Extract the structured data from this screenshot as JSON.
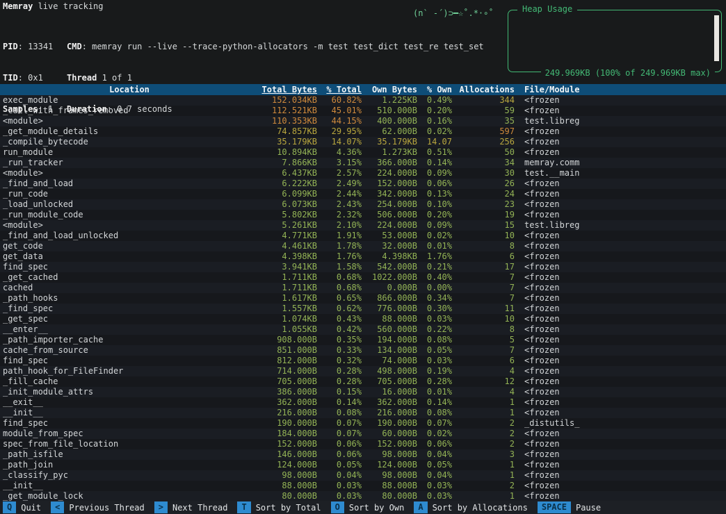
{
  "app": {
    "title_bold": "Memray",
    "title_rest": " live tracking",
    "kawaii_art": "(n` -´)⊃━☆˚.*·∘˚"
  },
  "stats": {
    "pid_label": "PID",
    "pid": "13341",
    "cmd_label": "CMD",
    "cmd": "memray run --live --trace-python-allocators -m test test_dict test_re test_set",
    "tid_label": "TID",
    "tid": "0x1",
    "thread_label": "Thread",
    "thread": "1 of 1",
    "samples_label": "Samples",
    "samples": "1",
    "duration_label": "Duration",
    "duration": "0.7 seconds"
  },
  "heap": {
    "title": "Heap Usage",
    "caption": "249.969KB (100% of 249.969KB max)"
  },
  "table": {
    "headers": {
      "location": "Location",
      "total_bytes": "Total Bytes",
      "pct_total": "% Total",
      "own_bytes": "Own Bytes",
      "pct_own": "% Own",
      "allocations": "Allocations",
      "file_module": "File/Module"
    },
    "sorted_columns": [
      "total_bytes",
      "pct_total"
    ],
    "rows": [
      {
        "location": "exec_module",
        "total": "152.034KB",
        "pct_total": "60.82%",
        "own": "1.225KB",
        "pct_own": "0.49%",
        "allocs": "344",
        "file": "<frozen",
        "tone_total": "orange",
        "tone_own": "green",
        "tone_alloc": "yellow"
      },
      {
        "location": "_call_with_frames_removed",
        "total": "112.521KB",
        "pct_total": "45.01%",
        "own": "510.000B",
        "pct_own": "0.20%",
        "allocs": "59",
        "file": "<frozen",
        "tone_total": "orange",
        "tone_own": "green",
        "tone_alloc": "green"
      },
      {
        "location": "<module>",
        "total": "110.353KB",
        "pct_total": "44.15%",
        "own": "400.000B",
        "pct_own": "0.16%",
        "allocs": "35",
        "file": "test.libreg",
        "tone_total": "orange",
        "tone_own": "green",
        "tone_alloc": "green"
      },
      {
        "location": "_get_module_details",
        "total": "74.857KB",
        "pct_total": "29.95%",
        "own": "62.000B",
        "pct_own": "0.02%",
        "allocs": "597",
        "file": "<frozen",
        "tone_total": "yellow",
        "tone_own": "green",
        "tone_alloc": "orange"
      },
      {
        "location": "_compile_bytecode",
        "total": "35.179KB",
        "pct_total": "14.07%",
        "own": "35.179KB",
        "pct_own": "14.07",
        "allocs": "256",
        "file": "<frozen",
        "tone_total": "yellow",
        "tone_own": "yellow",
        "tone_alloc": "yellow"
      },
      {
        "location": "run_module",
        "total": "10.894KB",
        "pct_total": "4.36%",
        "own": "1.273KB",
        "pct_own": "0.51%",
        "allocs": "50",
        "file": "<frozen",
        "tone_total": "green",
        "tone_own": "green",
        "tone_alloc": "green"
      },
      {
        "location": "_run_tracker",
        "total": "7.866KB",
        "pct_total": "3.15%",
        "own": "366.000B",
        "pct_own": "0.14%",
        "allocs": "34",
        "file": "memray.comm",
        "tone_total": "green",
        "tone_own": "green",
        "tone_alloc": "green"
      },
      {
        "location": "<module>",
        "total": "6.437KB",
        "pct_total": "2.57%",
        "own": "224.000B",
        "pct_own": "0.09%",
        "allocs": "30",
        "file": "test.__main",
        "tone_total": "green",
        "tone_own": "green",
        "tone_alloc": "green"
      },
      {
        "location": "_find_and_load",
        "total": "6.222KB",
        "pct_total": "2.49%",
        "own": "152.000B",
        "pct_own": "0.06%",
        "allocs": "26",
        "file": "<frozen",
        "tone_total": "green",
        "tone_own": "green",
        "tone_alloc": "green"
      },
      {
        "location": "_run_code",
        "total": "6.099KB",
        "pct_total": "2.44%",
        "own": "342.000B",
        "pct_own": "0.13%",
        "allocs": "24",
        "file": "<frozen",
        "tone_total": "green",
        "tone_own": "green",
        "tone_alloc": "green"
      },
      {
        "location": "_load_unlocked",
        "total": "6.073KB",
        "pct_total": "2.43%",
        "own": "254.000B",
        "pct_own": "0.10%",
        "allocs": "23",
        "file": "<frozen",
        "tone_total": "green",
        "tone_own": "green",
        "tone_alloc": "green"
      },
      {
        "location": "_run_module_code",
        "total": "5.802KB",
        "pct_total": "2.32%",
        "own": "506.000B",
        "pct_own": "0.20%",
        "allocs": "19",
        "file": "<frozen",
        "tone_total": "green",
        "tone_own": "green",
        "tone_alloc": "green"
      },
      {
        "location": "<module>",
        "total": "5.261KB",
        "pct_total": "2.10%",
        "own": "224.000B",
        "pct_own": "0.09%",
        "allocs": "15",
        "file": "test.libreg",
        "tone_total": "green",
        "tone_own": "green",
        "tone_alloc": "green"
      },
      {
        "location": "_find_and_load_unlocked",
        "total": "4.771KB",
        "pct_total": "1.91%",
        "own": "53.000B",
        "pct_own": "0.02%",
        "allocs": "10",
        "file": "<frozen",
        "tone_total": "green",
        "tone_own": "green",
        "tone_alloc": "green"
      },
      {
        "location": "get_code",
        "total": "4.461KB",
        "pct_total": "1.78%",
        "own": "32.000B",
        "pct_own": "0.01%",
        "allocs": "8",
        "file": "<frozen",
        "tone_total": "green",
        "tone_own": "green",
        "tone_alloc": "green"
      },
      {
        "location": "get_data",
        "total": "4.398KB",
        "pct_total": "1.76%",
        "own": "4.398KB",
        "pct_own": "1.76%",
        "allocs": "6",
        "file": "<frozen",
        "tone_total": "green",
        "tone_own": "green",
        "tone_alloc": "green"
      },
      {
        "location": "find_spec",
        "total": "3.941KB",
        "pct_total": "1.58%",
        "own": "542.000B",
        "pct_own": "0.21%",
        "allocs": "17",
        "file": "<frozen",
        "tone_total": "green",
        "tone_own": "green",
        "tone_alloc": "green"
      },
      {
        "location": "_get_cached",
        "total": "1.711KB",
        "pct_total": "0.68%",
        "own": "1022.000B",
        "pct_own": "0.40%",
        "allocs": "7",
        "file": "<frozen",
        "tone_total": "green",
        "tone_own": "green",
        "tone_alloc": "green"
      },
      {
        "location": "cached",
        "total": "1.711KB",
        "pct_total": "0.68%",
        "own": "0.000B",
        "pct_own": "0.00%",
        "allocs": "7",
        "file": "<frozen",
        "tone_total": "green",
        "tone_own": "green",
        "tone_alloc": "green"
      },
      {
        "location": "_path_hooks",
        "total": "1.617KB",
        "pct_total": "0.65%",
        "own": "866.000B",
        "pct_own": "0.34%",
        "allocs": "7",
        "file": "<frozen",
        "tone_total": "green",
        "tone_own": "green",
        "tone_alloc": "green"
      },
      {
        "location": "_find_spec",
        "total": "1.557KB",
        "pct_total": "0.62%",
        "own": "776.000B",
        "pct_own": "0.30%",
        "allocs": "11",
        "file": "<frozen",
        "tone_total": "green",
        "tone_own": "green",
        "tone_alloc": "green"
      },
      {
        "location": "_get_spec",
        "total": "1.074KB",
        "pct_total": "0.43%",
        "own": "88.000B",
        "pct_own": "0.03%",
        "allocs": "10",
        "file": "<frozen",
        "tone_total": "green",
        "tone_own": "green",
        "tone_alloc": "green"
      },
      {
        "location": "__enter__",
        "total": "1.055KB",
        "pct_total": "0.42%",
        "own": "560.000B",
        "pct_own": "0.22%",
        "allocs": "8",
        "file": "<frozen",
        "tone_total": "green",
        "tone_own": "green",
        "tone_alloc": "green"
      },
      {
        "location": "_path_importer_cache",
        "total": "908.000B",
        "pct_total": "0.35%",
        "own": "194.000B",
        "pct_own": "0.08%",
        "allocs": "5",
        "file": "<frozen",
        "tone_total": "green",
        "tone_own": "green",
        "tone_alloc": "green"
      },
      {
        "location": "cache_from_source",
        "total": "851.000B",
        "pct_total": "0.33%",
        "own": "134.000B",
        "pct_own": "0.05%",
        "allocs": "7",
        "file": "<frozen",
        "tone_total": "green",
        "tone_own": "green",
        "tone_alloc": "green"
      },
      {
        "location": "find_spec",
        "total": "812.000B",
        "pct_total": "0.32%",
        "own": "74.000B",
        "pct_own": "0.03%",
        "allocs": "6",
        "file": "<frozen",
        "tone_total": "green",
        "tone_own": "green",
        "tone_alloc": "green"
      },
      {
        "location": "path_hook_for_FileFinder",
        "total": "714.000B",
        "pct_total": "0.28%",
        "own": "498.000B",
        "pct_own": "0.19%",
        "allocs": "4",
        "file": "<frozen",
        "tone_total": "green",
        "tone_own": "green",
        "tone_alloc": "green"
      },
      {
        "location": "_fill_cache",
        "total": "705.000B",
        "pct_total": "0.28%",
        "own": "705.000B",
        "pct_own": "0.28%",
        "allocs": "12",
        "file": "<frozen",
        "tone_total": "green",
        "tone_own": "green",
        "tone_alloc": "green"
      },
      {
        "location": "_init_module_attrs",
        "total": "386.000B",
        "pct_total": "0.15%",
        "own": "16.000B",
        "pct_own": "0.01%",
        "allocs": "4",
        "file": "<frozen",
        "tone_total": "green",
        "tone_own": "green",
        "tone_alloc": "green"
      },
      {
        "location": "__exit__",
        "total": "362.000B",
        "pct_total": "0.14%",
        "own": "362.000B",
        "pct_own": "0.14%",
        "allocs": "1",
        "file": "<frozen",
        "tone_total": "green",
        "tone_own": "green",
        "tone_alloc": "green"
      },
      {
        "location": "__init__",
        "total": "216.000B",
        "pct_total": "0.08%",
        "own": "216.000B",
        "pct_own": "0.08%",
        "allocs": "1",
        "file": "<frozen",
        "tone_total": "green",
        "tone_own": "green",
        "tone_alloc": "green"
      },
      {
        "location": "find_spec",
        "total": "190.000B",
        "pct_total": "0.07%",
        "own": "190.000B",
        "pct_own": "0.07%",
        "allocs": "2",
        "file": "_distutils_",
        "tone_total": "green",
        "tone_own": "green",
        "tone_alloc": "green"
      },
      {
        "location": "module_from_spec",
        "total": "184.000B",
        "pct_total": "0.07%",
        "own": "60.000B",
        "pct_own": "0.02%",
        "allocs": "2",
        "file": "<frozen",
        "tone_total": "green",
        "tone_own": "green",
        "tone_alloc": "green"
      },
      {
        "location": "spec_from_file_location",
        "total": "152.000B",
        "pct_total": "0.06%",
        "own": "152.000B",
        "pct_own": "0.06%",
        "allocs": "2",
        "file": "<frozen",
        "tone_total": "green",
        "tone_own": "green",
        "tone_alloc": "green"
      },
      {
        "location": "_path_isfile",
        "total": "146.000B",
        "pct_total": "0.06%",
        "own": "98.000B",
        "pct_own": "0.04%",
        "allocs": "3",
        "file": "<frozen",
        "tone_total": "green",
        "tone_own": "green",
        "tone_alloc": "green"
      },
      {
        "location": "_path_join",
        "total": "124.000B",
        "pct_total": "0.05%",
        "own": "124.000B",
        "pct_own": "0.05%",
        "allocs": "1",
        "file": "<frozen",
        "tone_total": "green",
        "tone_own": "green",
        "tone_alloc": "green"
      },
      {
        "location": "_classify_pyc",
        "total": "98.000B",
        "pct_total": "0.04%",
        "own": "98.000B",
        "pct_own": "0.04%",
        "allocs": "1",
        "file": "<frozen",
        "tone_total": "green",
        "tone_own": "green",
        "tone_alloc": "green"
      },
      {
        "location": "__init__",
        "total": "88.000B",
        "pct_total": "0.03%",
        "own": "88.000B",
        "pct_own": "0.03%",
        "allocs": "2",
        "file": "<frozen",
        "tone_total": "green",
        "tone_own": "green",
        "tone_alloc": "green"
      },
      {
        "location": "_get_module_lock",
        "total": "80.000B",
        "pct_total": "0.03%",
        "own": "80.000B",
        "pct_own": "0.03%",
        "allocs": "1",
        "file": "<frozen",
        "tone_total": "green",
        "tone_own": "green",
        "tone_alloc": "green"
      }
    ]
  },
  "footer": {
    "items": [
      {
        "key": "Q",
        "label": "Quit"
      },
      {
        "key": "<",
        "label": "Previous Thread"
      },
      {
        "key": ">",
        "label": "Next Thread"
      },
      {
        "key": "T",
        "label": "Sort by Total"
      },
      {
        "key": "O",
        "label": "Sort by Own"
      },
      {
        "key": "A",
        "label": "Sort by Allocations"
      },
      {
        "key": "SPACE",
        "label": "Pause"
      }
    ]
  },
  "colors": {
    "background": "#181a1b",
    "header_row_bg": "#0e4d78",
    "heap_green": "#43b975",
    "kawaii_green": "#6fcf97",
    "value_green": "#93b355",
    "value_yellow": "#b9a73e",
    "value_orange": "#cf8a3c",
    "badge_blue": "#2e8bd0",
    "scrollbar_white": "#e8e6e2"
  }
}
